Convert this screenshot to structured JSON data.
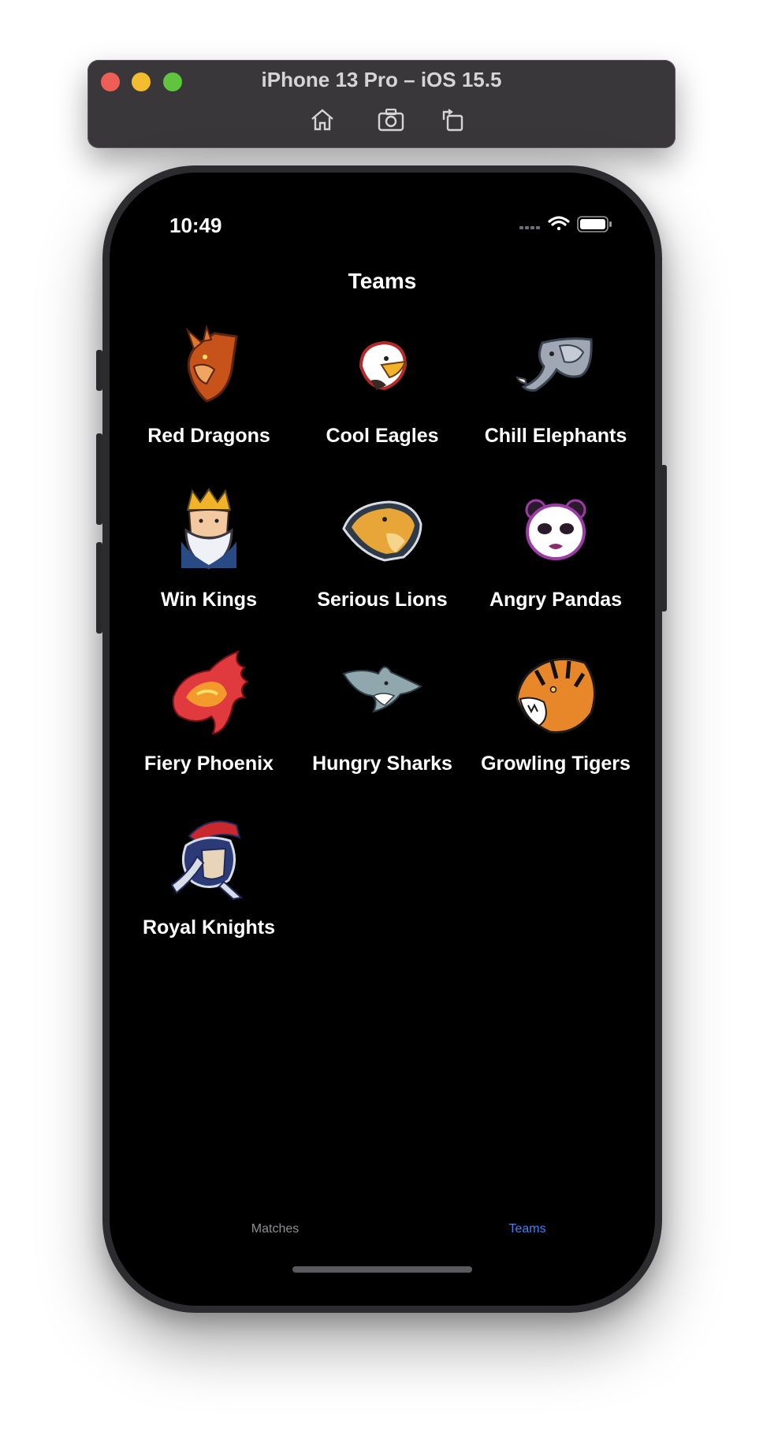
{
  "window": {
    "title": "iPhone 13 Pro – iOS 15.5",
    "toolbar_icons": [
      "home-icon",
      "screenshot-icon",
      "rotate-icon"
    ]
  },
  "status_bar": {
    "time": "10:49"
  },
  "nav": {
    "title": "Teams"
  },
  "teams": [
    {
      "name": "Red Dragons",
      "icon": "dragon-logo"
    },
    {
      "name": "Cool Eagles",
      "icon": "eagle-logo"
    },
    {
      "name": "Chill Elephants",
      "icon": "elephant-logo"
    },
    {
      "name": "Win Kings",
      "icon": "king-logo"
    },
    {
      "name": "Serious Lions",
      "icon": "lion-logo"
    },
    {
      "name": "Angry Pandas",
      "icon": "panda-logo"
    },
    {
      "name": "Fiery Phoenix",
      "icon": "phoenix-logo"
    },
    {
      "name": "Hungry Sharks",
      "icon": "shark-logo"
    },
    {
      "name": "Growling Tigers",
      "icon": "tiger-logo"
    },
    {
      "name": "Royal Knights",
      "icon": "knight-logo"
    }
  ],
  "tab_bar": {
    "tabs": [
      {
        "label": "Matches",
        "selected": false
      },
      {
        "label": "Teams",
        "selected": true
      }
    ],
    "selected_color": "#3B82F6",
    "unselected_color": "#8E8E93"
  }
}
